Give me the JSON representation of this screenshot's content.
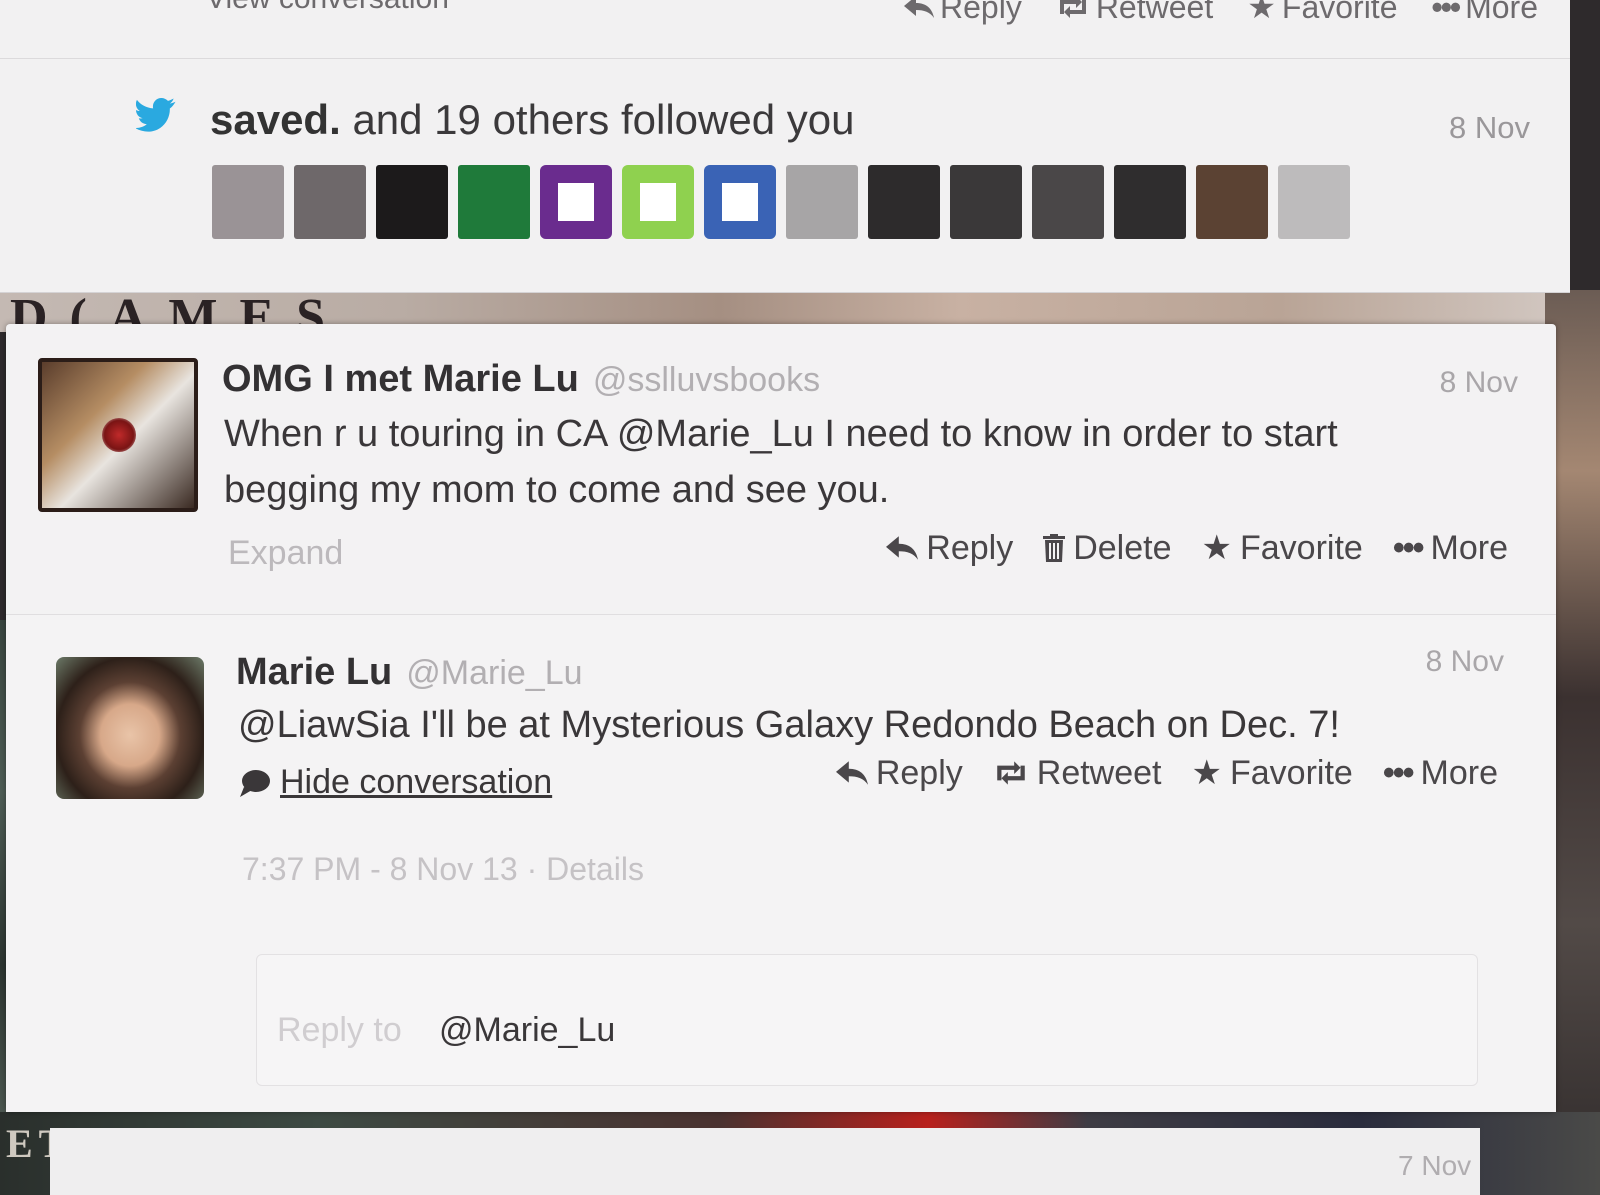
{
  "previous_tweet": {
    "left_link": "View conversation",
    "actions": [
      "Reply",
      "Retweet",
      "Favorite",
      "More"
    ]
  },
  "follow_notification": {
    "user": "saved.",
    "text": "and 19 others followed you",
    "date": "8 Nov",
    "avatar_colors": [
      "#9a9396",
      "#6e686a",
      "#1c1a1b",
      "#1f7a3a",
      "#6a2c8e",
      "#8fd14f",
      "#3a63b5",
      "#a7a5a6",
      "#2d2b2c",
      "#3a3839",
      "#4a4748",
      "#2f2d2e",
      "#5b4233",
      "#bdbbbc"
    ]
  },
  "tweet_1": {
    "display_name": "OMG I met Marie Lu",
    "handle": "@sslluvsbooks",
    "date": "8 Nov",
    "text_line1": "When r u touring in CA @Marie_Lu I need to know in order to start",
    "text_line2": "begging my mom to come and see you.",
    "expand": "Expand",
    "actions": {
      "reply": "Reply",
      "delete": "Delete",
      "favorite": "Favorite",
      "more": "More"
    }
  },
  "tweet_2": {
    "display_name": "Marie Lu",
    "handle": "@Marie_Lu",
    "date": "8 Nov",
    "text": "@LiawSia I'll be at Mysterious Galaxy Redondo Beach on Dec. 7!",
    "hide_conversation": "Hide conversation",
    "actions": {
      "reply": "Reply",
      "retweet": "Retweet",
      "favorite": "Favorite",
      "more": "More"
    },
    "timestamp": "7:37 PM - 8 Nov 13",
    "details": "Details"
  },
  "reply_box": {
    "placeholder": "Reply to",
    "mention": "@Marie_Lu"
  },
  "next_tweet": {
    "date": "7 Nov"
  },
  "colors": {
    "twitter_blue": "#2aa9e0",
    "panel_bg": "#f3f2f3"
  }
}
